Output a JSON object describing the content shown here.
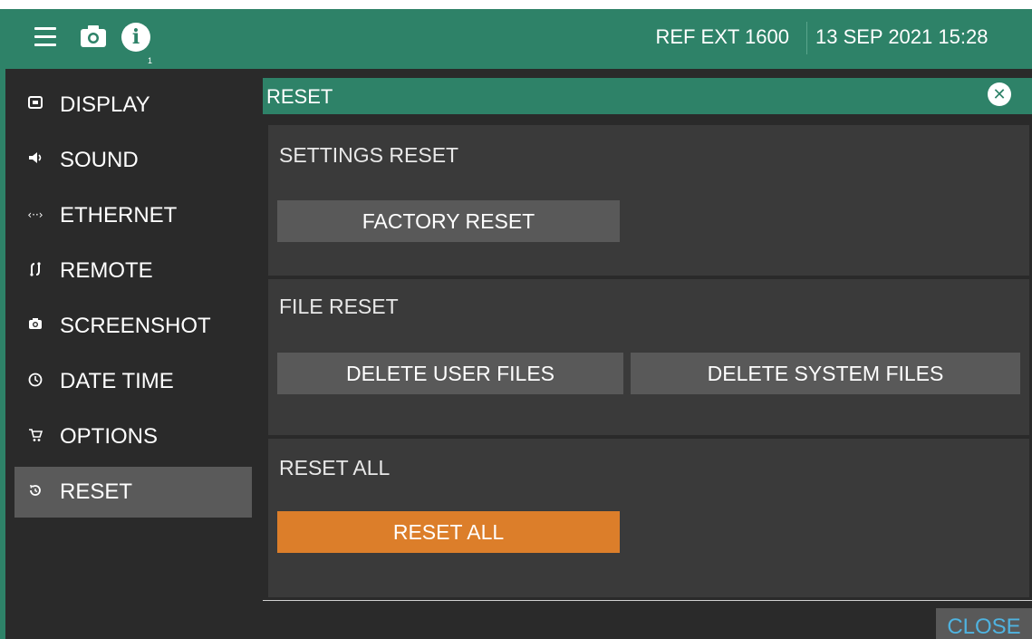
{
  "topbar": {
    "reference": "REF EXT 1600",
    "datetime": "13 SEP 2021 15:28",
    "info_badge": "1"
  },
  "sidebar": {
    "items": [
      {
        "label": "DISPLAY",
        "icon": "display-icon"
      },
      {
        "label": "SOUND",
        "icon": "speaker-icon"
      },
      {
        "label": "ETHERNET",
        "icon": "ethernet-icon"
      },
      {
        "label": "REMOTE",
        "icon": "remote-icon"
      },
      {
        "label": "SCREENSHOT",
        "icon": "camera-icon"
      },
      {
        "label": "DATE TIME",
        "icon": "clock-icon"
      },
      {
        "label": "OPTIONS",
        "icon": "cart-icon"
      },
      {
        "label": "RESET",
        "icon": "reset-icon",
        "active": true
      }
    ]
  },
  "dialog": {
    "title": "RESET",
    "close_label": "CLOSE"
  },
  "settings_reset": {
    "title": "SETTINGS RESET",
    "factory_reset_label": "FACTORY RESET"
  },
  "file_reset": {
    "title": "FILE RESET",
    "delete_user_label": "DELETE USER FILES",
    "delete_system_label": "DELETE SYSTEM FILES"
  },
  "reset_all": {
    "title": "RESET ALL",
    "button_label": "RESET ALL"
  },
  "colors": {
    "header_green": "#2e8268",
    "reset_all_orange": "#dc7e2a",
    "close_text_blue": "#4fb3e0"
  }
}
